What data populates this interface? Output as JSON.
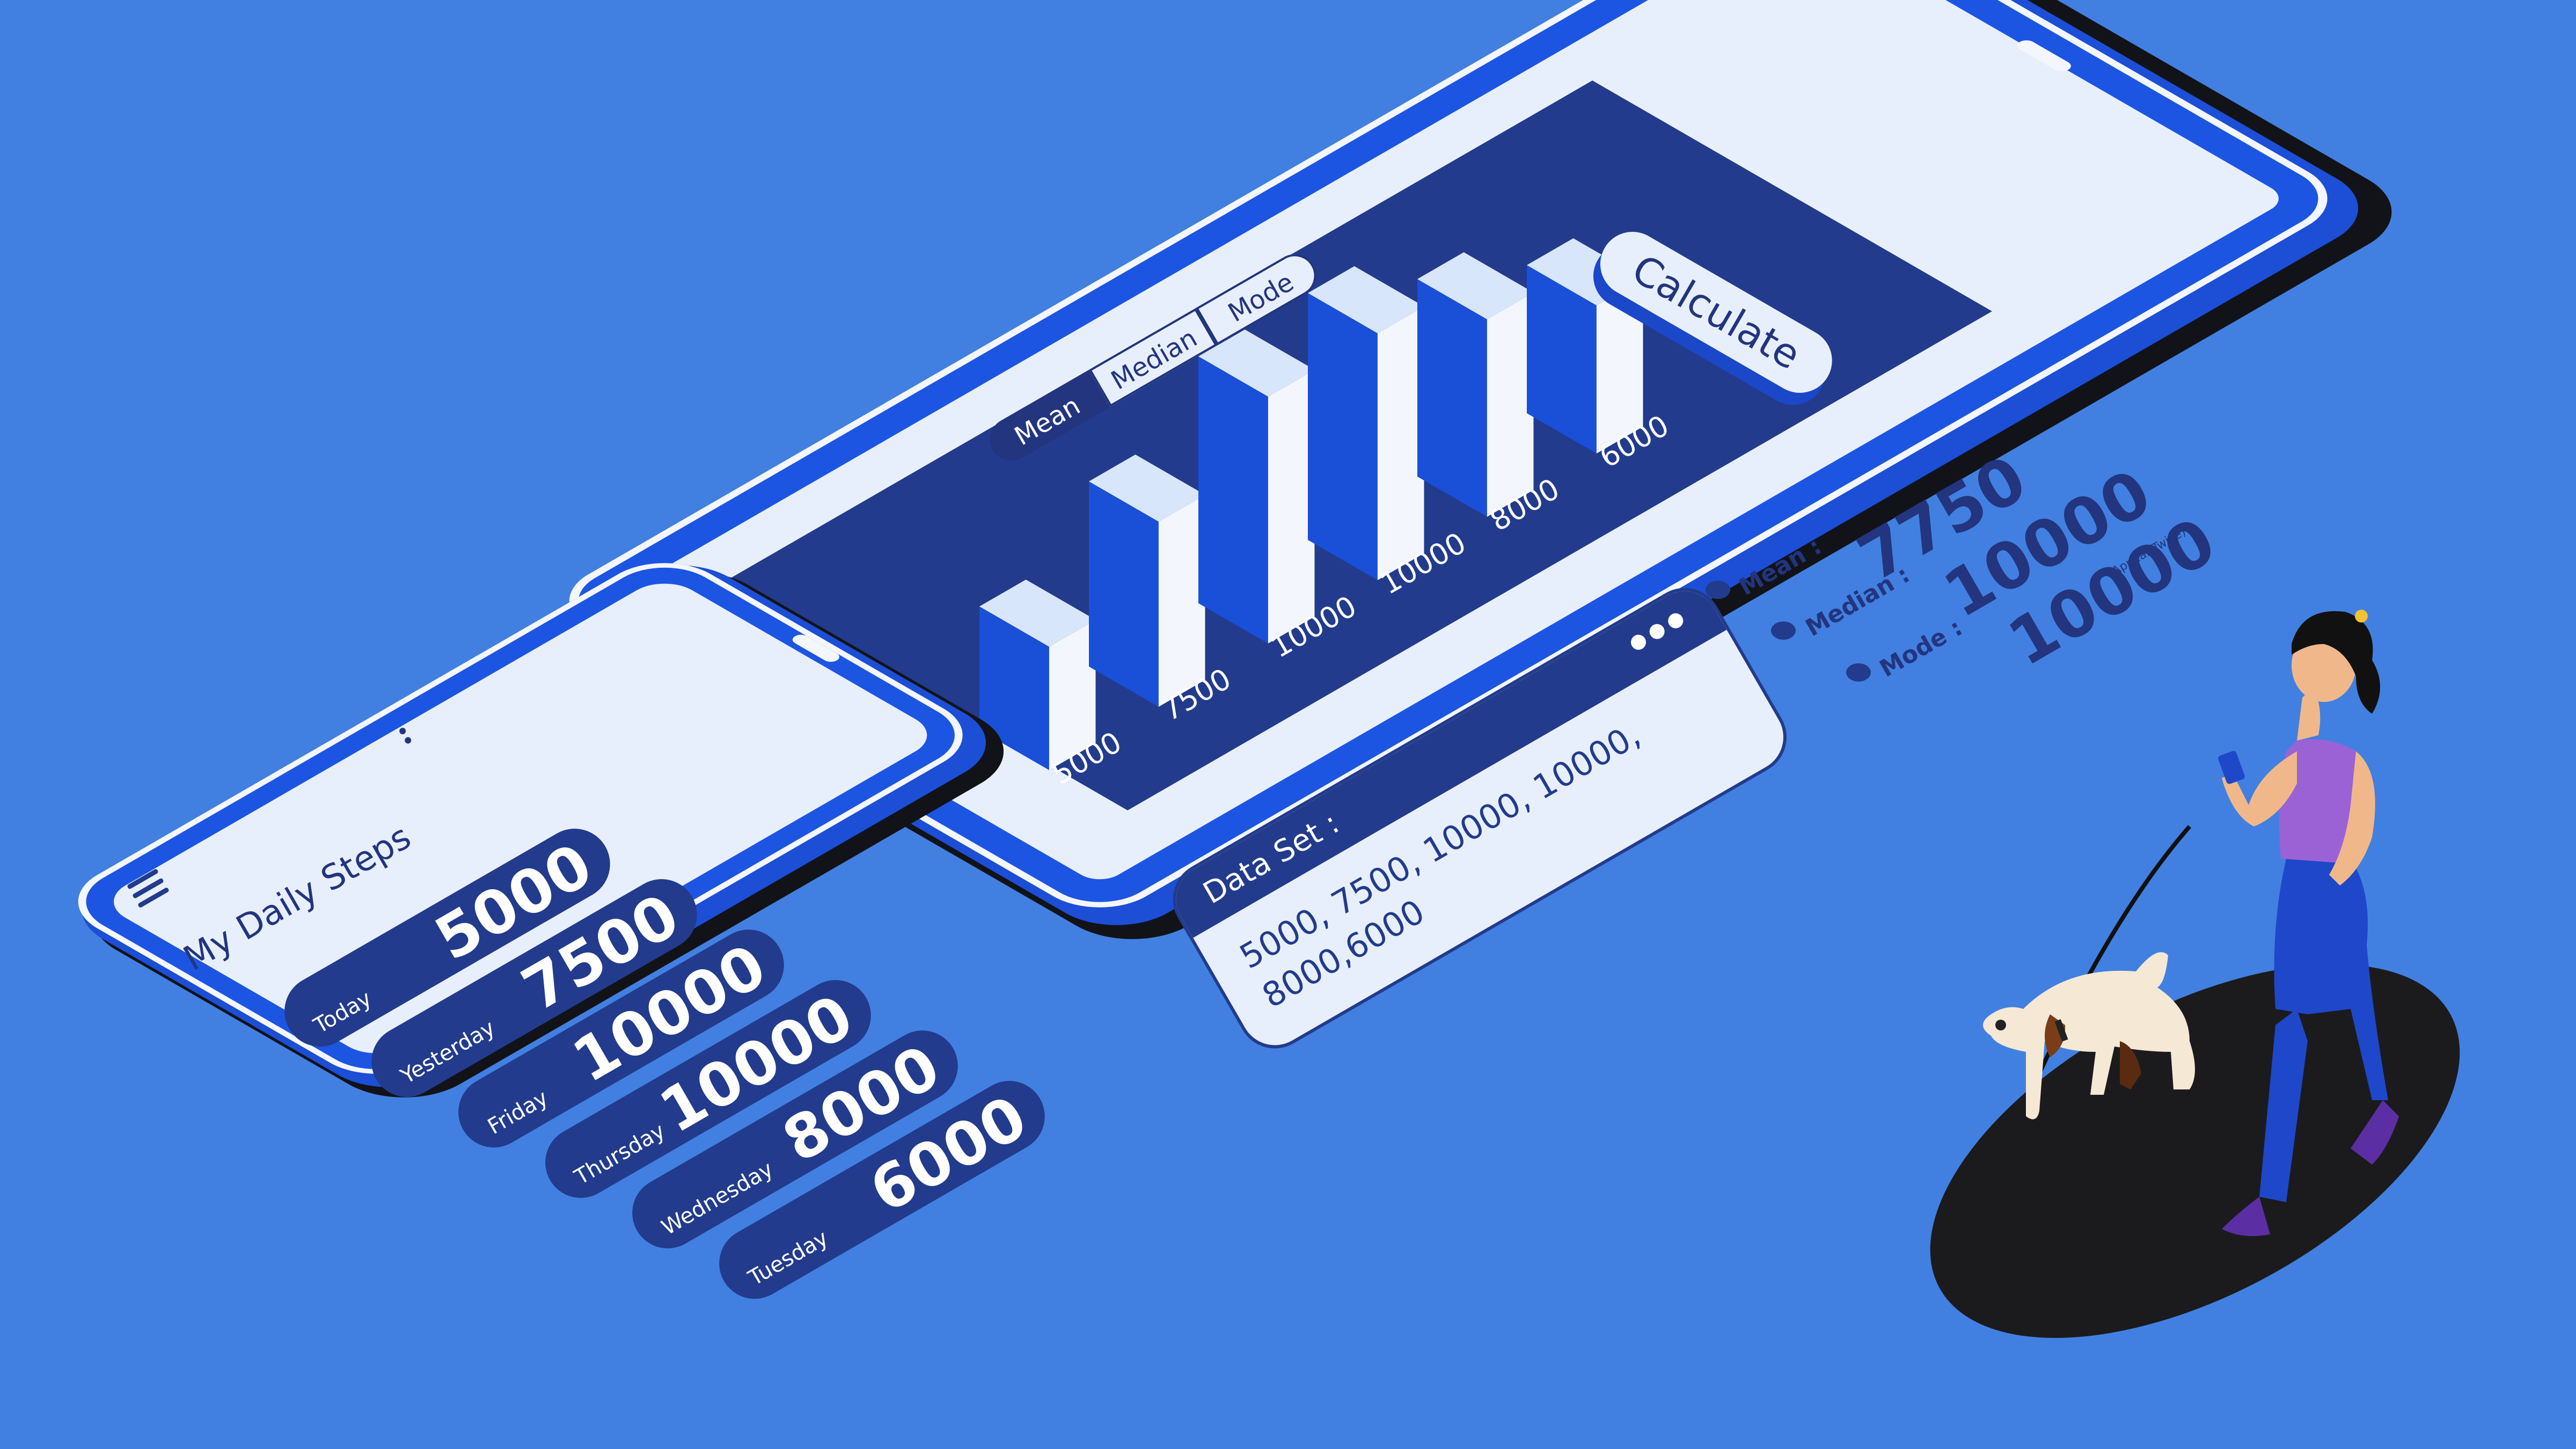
{
  "tablet": {
    "tabs": [
      {
        "label": "Mean",
        "active": true
      },
      {
        "label": "Median",
        "active": false
      },
      {
        "label": "Mode",
        "active": false
      }
    ],
    "calculate_label": "Calculate",
    "stats": {
      "mean_label": "Mean :",
      "mean_value": "7750",
      "median_label": "Median :",
      "median_value": "10000",
      "mode_label": "Mode :",
      "mode_value": "10000",
      "mode_note": "(Appear Twice)"
    },
    "dataset": {
      "title": "Data Set :",
      "values_text": "5000, 7500, 10000, 10000, 8000,6000"
    }
  },
  "chart_data": {
    "type": "bar",
    "categories": [
      "5000",
      "7500",
      "10000",
      "10000",
      "8000",
      "6000"
    ],
    "values": [
      5000,
      7500,
      10000,
      10000,
      8000,
      6000
    ],
    "title": "",
    "xlabel": "",
    "ylabel": "",
    "ylim": [
      0,
      10000
    ],
    "grid": false,
    "legend": "none",
    "colors": {
      "bar_front": "#1a4fd8",
      "bar_side": "#f3f6fd",
      "bar_top": "#d8e6fb",
      "panel": "#223b8c",
      "labels": "#ffffff"
    }
  },
  "phone": {
    "title": "My Daily Steps",
    "menu_icon": "hamburger-menu-icon",
    "overflow_icon": "vertical-dots-icon",
    "rows": [
      {
        "label": "Today",
        "value": "5000"
      },
      {
        "label": "Yesterday",
        "value": "7500"
      },
      {
        "label": "Friday",
        "value": "10000"
      },
      {
        "label": "Thursday",
        "value": "10000"
      },
      {
        "label": "Wednesday",
        "value": "8000"
      },
      {
        "label": "Tuesday",
        "value": "6000"
      }
    ]
  },
  "colors": {
    "background": "#4180e0",
    "device_blue": "#1d55e3",
    "navy": "#223b8c",
    "screen": "#e8effc",
    "shadow": "#111318"
  }
}
